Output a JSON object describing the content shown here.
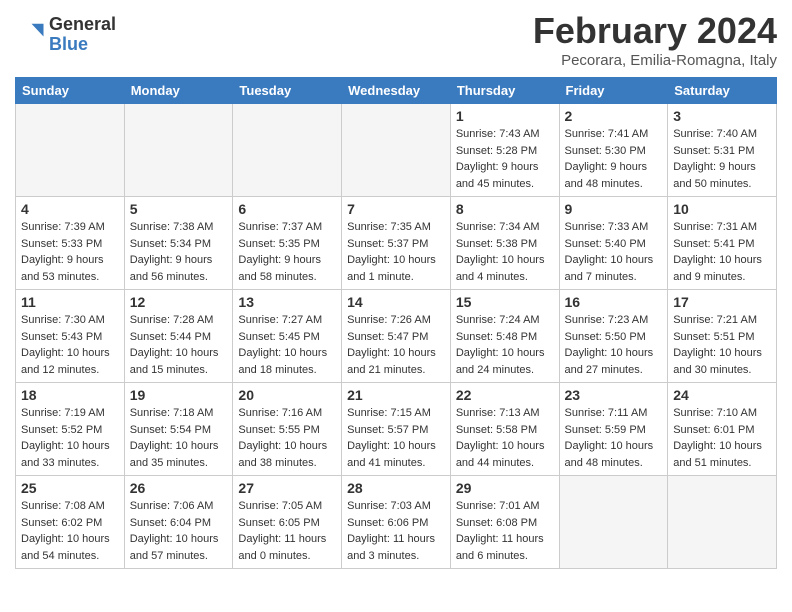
{
  "header": {
    "logo_general": "General",
    "logo_blue": "Blue",
    "title": "February 2024",
    "location": "Pecorara, Emilia-Romagna, Italy"
  },
  "days_of_week": [
    "Sunday",
    "Monday",
    "Tuesday",
    "Wednesday",
    "Thursday",
    "Friday",
    "Saturday"
  ],
  "weeks": [
    [
      {
        "num": "",
        "info": ""
      },
      {
        "num": "",
        "info": ""
      },
      {
        "num": "",
        "info": ""
      },
      {
        "num": "",
        "info": ""
      },
      {
        "num": "1",
        "info": "Sunrise: 7:43 AM\nSunset: 5:28 PM\nDaylight: 9 hours\nand 45 minutes."
      },
      {
        "num": "2",
        "info": "Sunrise: 7:41 AM\nSunset: 5:30 PM\nDaylight: 9 hours\nand 48 minutes."
      },
      {
        "num": "3",
        "info": "Sunrise: 7:40 AM\nSunset: 5:31 PM\nDaylight: 9 hours\nand 50 minutes."
      }
    ],
    [
      {
        "num": "4",
        "info": "Sunrise: 7:39 AM\nSunset: 5:33 PM\nDaylight: 9 hours\nand 53 minutes."
      },
      {
        "num": "5",
        "info": "Sunrise: 7:38 AM\nSunset: 5:34 PM\nDaylight: 9 hours\nand 56 minutes."
      },
      {
        "num": "6",
        "info": "Sunrise: 7:37 AM\nSunset: 5:35 PM\nDaylight: 9 hours\nand 58 minutes."
      },
      {
        "num": "7",
        "info": "Sunrise: 7:35 AM\nSunset: 5:37 PM\nDaylight: 10 hours\nand 1 minute."
      },
      {
        "num": "8",
        "info": "Sunrise: 7:34 AM\nSunset: 5:38 PM\nDaylight: 10 hours\nand 4 minutes."
      },
      {
        "num": "9",
        "info": "Sunrise: 7:33 AM\nSunset: 5:40 PM\nDaylight: 10 hours\nand 7 minutes."
      },
      {
        "num": "10",
        "info": "Sunrise: 7:31 AM\nSunset: 5:41 PM\nDaylight: 10 hours\nand 9 minutes."
      }
    ],
    [
      {
        "num": "11",
        "info": "Sunrise: 7:30 AM\nSunset: 5:43 PM\nDaylight: 10 hours\nand 12 minutes."
      },
      {
        "num": "12",
        "info": "Sunrise: 7:28 AM\nSunset: 5:44 PM\nDaylight: 10 hours\nand 15 minutes."
      },
      {
        "num": "13",
        "info": "Sunrise: 7:27 AM\nSunset: 5:45 PM\nDaylight: 10 hours\nand 18 minutes."
      },
      {
        "num": "14",
        "info": "Sunrise: 7:26 AM\nSunset: 5:47 PM\nDaylight: 10 hours\nand 21 minutes."
      },
      {
        "num": "15",
        "info": "Sunrise: 7:24 AM\nSunset: 5:48 PM\nDaylight: 10 hours\nand 24 minutes."
      },
      {
        "num": "16",
        "info": "Sunrise: 7:23 AM\nSunset: 5:50 PM\nDaylight: 10 hours\nand 27 minutes."
      },
      {
        "num": "17",
        "info": "Sunrise: 7:21 AM\nSunset: 5:51 PM\nDaylight: 10 hours\nand 30 minutes."
      }
    ],
    [
      {
        "num": "18",
        "info": "Sunrise: 7:19 AM\nSunset: 5:52 PM\nDaylight: 10 hours\nand 33 minutes."
      },
      {
        "num": "19",
        "info": "Sunrise: 7:18 AM\nSunset: 5:54 PM\nDaylight: 10 hours\nand 35 minutes."
      },
      {
        "num": "20",
        "info": "Sunrise: 7:16 AM\nSunset: 5:55 PM\nDaylight: 10 hours\nand 38 minutes."
      },
      {
        "num": "21",
        "info": "Sunrise: 7:15 AM\nSunset: 5:57 PM\nDaylight: 10 hours\nand 41 minutes."
      },
      {
        "num": "22",
        "info": "Sunrise: 7:13 AM\nSunset: 5:58 PM\nDaylight: 10 hours\nand 44 minutes."
      },
      {
        "num": "23",
        "info": "Sunrise: 7:11 AM\nSunset: 5:59 PM\nDaylight: 10 hours\nand 48 minutes."
      },
      {
        "num": "24",
        "info": "Sunrise: 7:10 AM\nSunset: 6:01 PM\nDaylight: 10 hours\nand 51 minutes."
      }
    ],
    [
      {
        "num": "25",
        "info": "Sunrise: 7:08 AM\nSunset: 6:02 PM\nDaylight: 10 hours\nand 54 minutes."
      },
      {
        "num": "26",
        "info": "Sunrise: 7:06 AM\nSunset: 6:04 PM\nDaylight: 10 hours\nand 57 minutes."
      },
      {
        "num": "27",
        "info": "Sunrise: 7:05 AM\nSunset: 6:05 PM\nDaylight: 11 hours\nand 0 minutes."
      },
      {
        "num": "28",
        "info": "Sunrise: 7:03 AM\nSunset: 6:06 PM\nDaylight: 11 hours\nand 3 minutes."
      },
      {
        "num": "29",
        "info": "Sunrise: 7:01 AM\nSunset: 6:08 PM\nDaylight: 11 hours\nand 6 minutes."
      },
      {
        "num": "",
        "info": ""
      },
      {
        "num": "",
        "info": ""
      }
    ]
  ]
}
